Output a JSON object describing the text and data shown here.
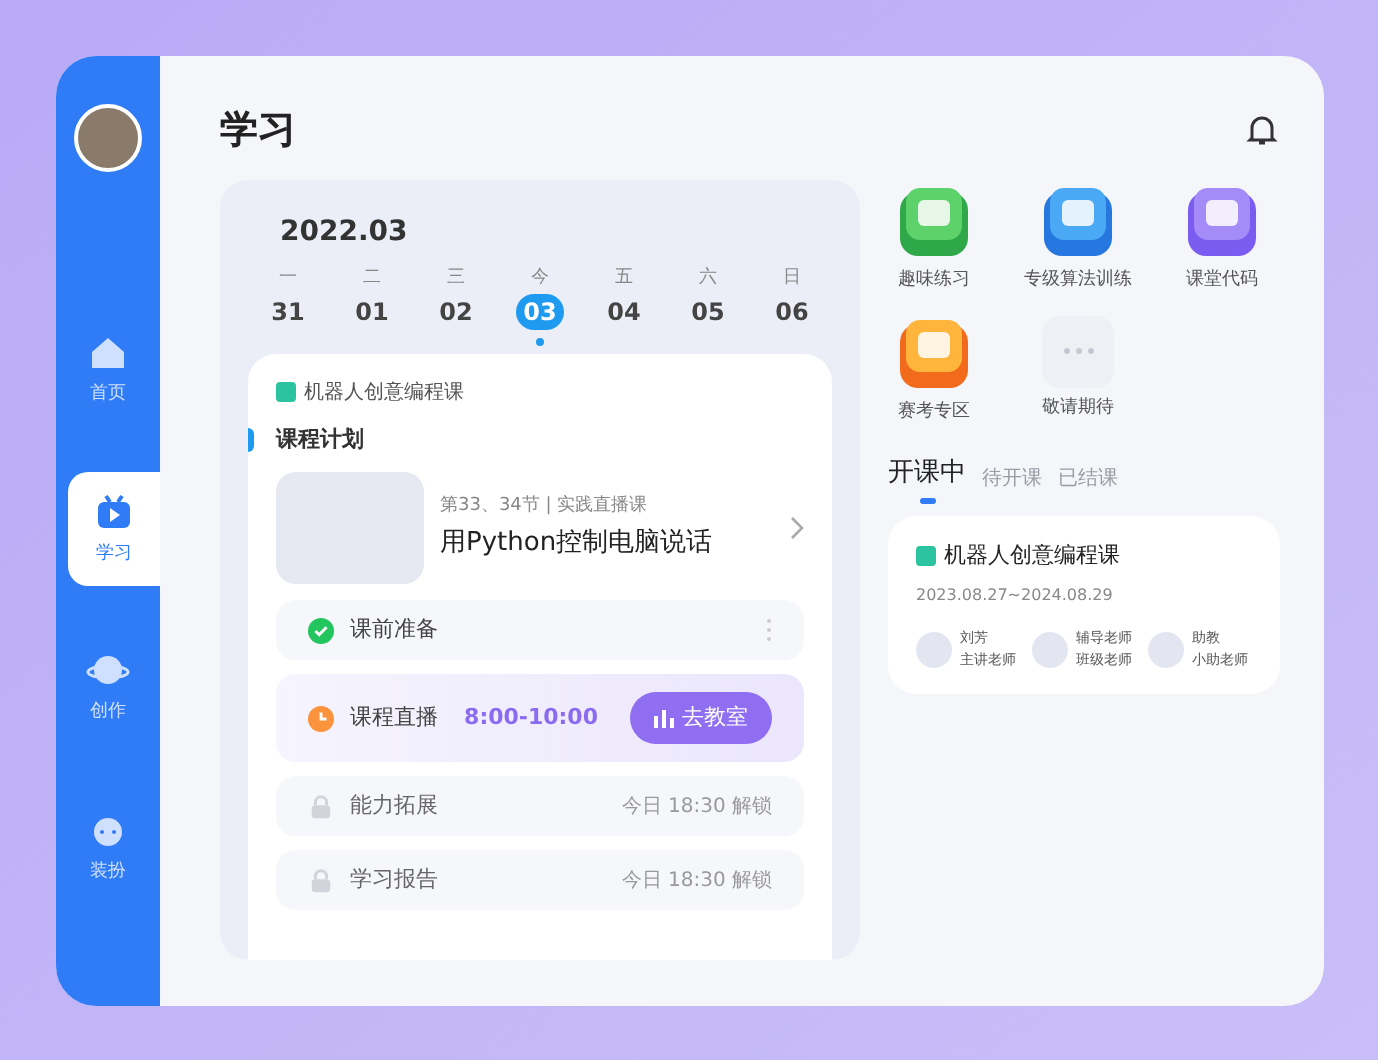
{
  "header": {
    "title": "学习"
  },
  "sidebar": {
    "items": [
      {
        "label": "首页",
        "selected": false
      },
      {
        "label": "学习",
        "selected": true
      },
      {
        "label": "创作",
        "selected": false
      },
      {
        "label": "装扮",
        "selected": false
      }
    ]
  },
  "calendar": {
    "month": "2022.03",
    "days": [
      {
        "weekday": "一",
        "date": "31",
        "selected": false
      },
      {
        "weekday": "二",
        "date": "01",
        "selected": false
      },
      {
        "weekday": "三",
        "date": "02",
        "selected": false
      },
      {
        "weekday": "今",
        "date": "03",
        "selected": true
      },
      {
        "weekday": "五",
        "date": "04",
        "selected": false
      },
      {
        "weekday": "六",
        "date": "05",
        "selected": false
      },
      {
        "weekday": "日",
        "date": "06",
        "selected": false
      }
    ]
  },
  "course": {
    "name": "机器人创意编程课",
    "section": "课程计划",
    "lesson": {
      "meta": "第33、34节 | 实践直播课",
      "title": "用Python控制电脑说话"
    },
    "steps": [
      {
        "kind": "done",
        "label": "课前准备"
      },
      {
        "kind": "live",
        "label": "课程直播",
        "time": "8:00-10:00",
        "button": "去教室"
      },
      {
        "kind": "locked",
        "label": "能力拓展",
        "note": "今日 18:30 解锁"
      },
      {
        "kind": "locked",
        "label": "学习报告",
        "note": "今日 18:30 解锁"
      }
    ]
  },
  "shortcuts": [
    {
      "kind": "green",
      "label": "趣味练习"
    },
    {
      "kind": "blue",
      "label": "专级算法训练"
    },
    {
      "kind": "purple",
      "label": "课堂代码"
    },
    {
      "kind": "orange",
      "label": "赛考专区"
    },
    {
      "kind": "more",
      "label": "敬请期待"
    }
  ],
  "tabs": [
    {
      "label": "开课中",
      "selected": true
    },
    {
      "label": "待开课",
      "selected": false
    },
    {
      "label": "已结课",
      "selected": false
    }
  ],
  "class_card": {
    "title": "机器人创意编程课",
    "dates": "2023.08.27~2024.08.29",
    "teachers": [
      {
        "name": "刘芳",
        "role": "主讲老师"
      },
      {
        "name": "辅导老师",
        "role": "班级老师"
      },
      {
        "name": "助教",
        "role": "小助老师"
      }
    ]
  }
}
